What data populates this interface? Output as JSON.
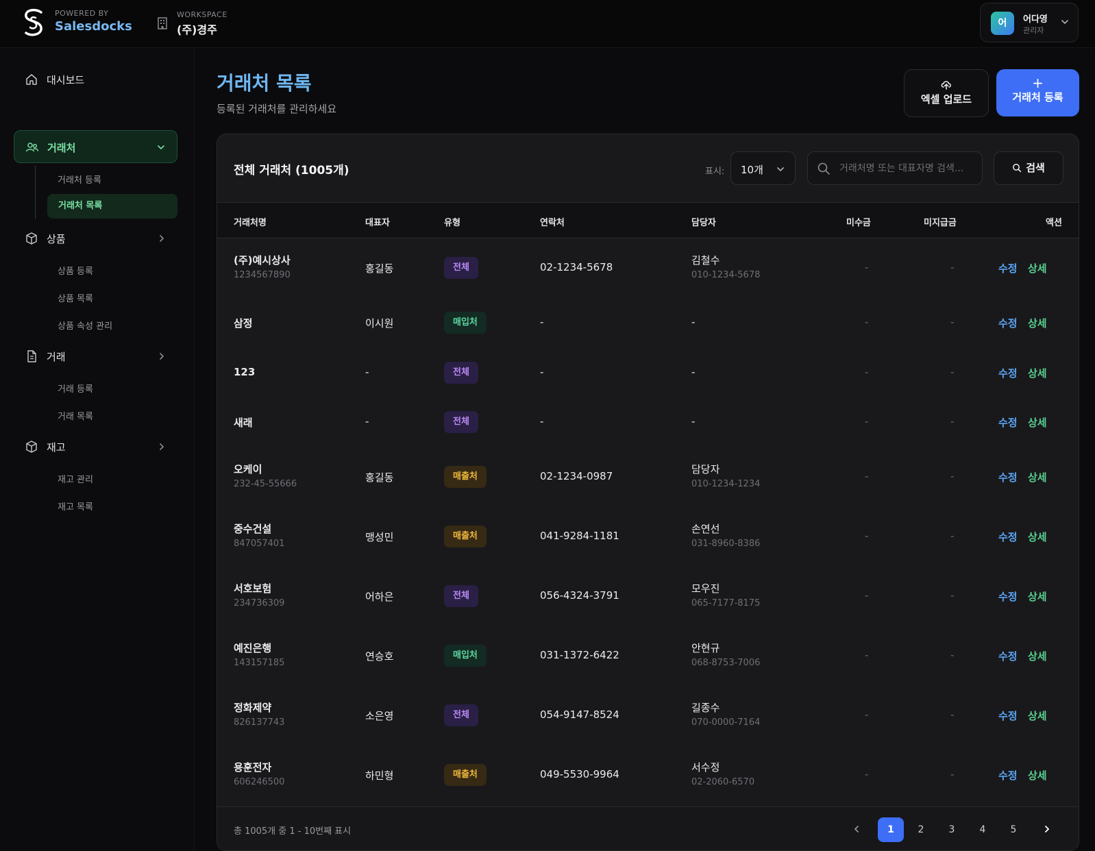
{
  "header": {
    "powered_by": "POWERED BY",
    "brand": "Salesdocks",
    "workspace_label": "WORKSPACE",
    "workspace_name": "(주)경주",
    "user": {
      "initial": "어",
      "name": "어다영",
      "role": "관리자"
    }
  },
  "sidebar": {
    "dashboard": "대시보드",
    "groups": [
      {
        "label": "거래처",
        "icon": "users-icon",
        "expanded": true,
        "items": [
          "거래처 등록",
          "거래처 목록"
        ],
        "active_item": "거래처 목록"
      },
      {
        "label": "상품",
        "icon": "box-icon",
        "expanded": false,
        "items": [
          "상품 등록",
          "상품 목록",
          "상품 속성 관리"
        ]
      },
      {
        "label": "거래",
        "icon": "document-icon",
        "expanded": false,
        "items": [
          "거래 등록",
          "거래 목록"
        ]
      },
      {
        "label": "재고",
        "icon": "box-icon",
        "expanded": false,
        "items": [
          "재고 관리",
          "재고 목록"
        ]
      }
    ]
  },
  "page": {
    "title": "거래처 목록",
    "subtitle": "등록된 거래처를 관리하세요",
    "upload_label": "엑셀 업로드",
    "add_label": "거래처 등록",
    "add_plus": "+"
  },
  "table": {
    "title": "전체 거래처 (1005개)",
    "show_label": "표시:",
    "page_size": "10개",
    "search_placeholder": "거래처명 또는 대표자명 검색...",
    "search_button": "검색",
    "columns": [
      "거래처명",
      "대표자",
      "유형",
      "연락처",
      "담당자",
      "미수금",
      "미지급금",
      "액션"
    ],
    "rows": [
      {
        "name": "(주)예시상사",
        "biz_no": "1234567890",
        "ceo": "홍길동",
        "type": "전체",
        "type_kind": "all",
        "phone": "02-1234-5678",
        "manager": "김철수",
        "manager_phone": "010-1234-5678",
        "receivable": "-",
        "payable": "-"
      },
      {
        "name": "삼정",
        "biz_no": "",
        "ceo": "이시원",
        "type": "매입처",
        "type_kind": "buy",
        "phone": "-",
        "manager": "-",
        "manager_phone": "",
        "receivable": "-",
        "payable": "-"
      },
      {
        "name": "123",
        "biz_no": "",
        "ceo": "-",
        "type": "전체",
        "type_kind": "all",
        "phone": "-",
        "manager": "-",
        "manager_phone": "",
        "receivable": "-",
        "payable": "-"
      },
      {
        "name": "새래",
        "biz_no": "",
        "ceo": "-",
        "type": "전체",
        "type_kind": "all",
        "phone": "-",
        "manager": "-",
        "manager_phone": "",
        "receivable": "-",
        "payable": "-"
      },
      {
        "name": "오케이",
        "biz_no": "232-45-55666",
        "ceo": "홍길동",
        "type": "매출처",
        "type_kind": "sell",
        "phone": "02-1234-0987",
        "manager": "담당자",
        "manager_phone": "010-1234-1234",
        "receivable": "-",
        "payable": "-"
      },
      {
        "name": "중수건설",
        "biz_no": "847057401",
        "ceo": "맹성민",
        "type": "매출처",
        "type_kind": "sell",
        "phone": "041-9284-1181",
        "manager": "손연선",
        "manager_phone": "031-8960-8386",
        "receivable": "-",
        "payable": "-"
      },
      {
        "name": "서호보험",
        "biz_no": "234736309",
        "ceo": "어하은",
        "type": "전체",
        "type_kind": "all",
        "phone": "056-4324-3791",
        "manager": "모우진",
        "manager_phone": "065-7177-8175",
        "receivable": "-",
        "payable": "-"
      },
      {
        "name": "예진은행",
        "biz_no": "143157185",
        "ceo": "연승호",
        "type": "매입처",
        "type_kind": "buy",
        "phone": "031-1372-6422",
        "manager": "안현규",
        "manager_phone": "068-8753-7006",
        "receivable": "-",
        "payable": "-"
      },
      {
        "name": "정화제약",
        "biz_no": "826137743",
        "ceo": "소은영",
        "type": "전체",
        "type_kind": "all",
        "phone": "054-9147-8524",
        "manager": "길종수",
        "manager_phone": "070-0000-7164",
        "receivable": "-",
        "payable": "-"
      },
      {
        "name": "용훈전자",
        "biz_no": "606246500",
        "ceo": "하민형",
        "type": "매출처",
        "type_kind": "sell",
        "phone": "049-5530-9964",
        "manager": "서수정",
        "manager_phone": "02-2060-6570",
        "receivable": "-",
        "payable": "-"
      }
    ],
    "action_edit": "수정",
    "action_detail": "상세"
  },
  "pagination": {
    "summary": "총 1005개 중 1 - 10번째 표시",
    "pages": [
      "1",
      "2",
      "3",
      "4",
      "5"
    ],
    "current": "1"
  },
  "colors": {
    "accent_blue": "#3d6ef5",
    "active_green": "#7be0a3",
    "badge_all": "#b88af5",
    "badge_buy": "#5dd6a3",
    "badge_sell": "#f0b83c"
  }
}
